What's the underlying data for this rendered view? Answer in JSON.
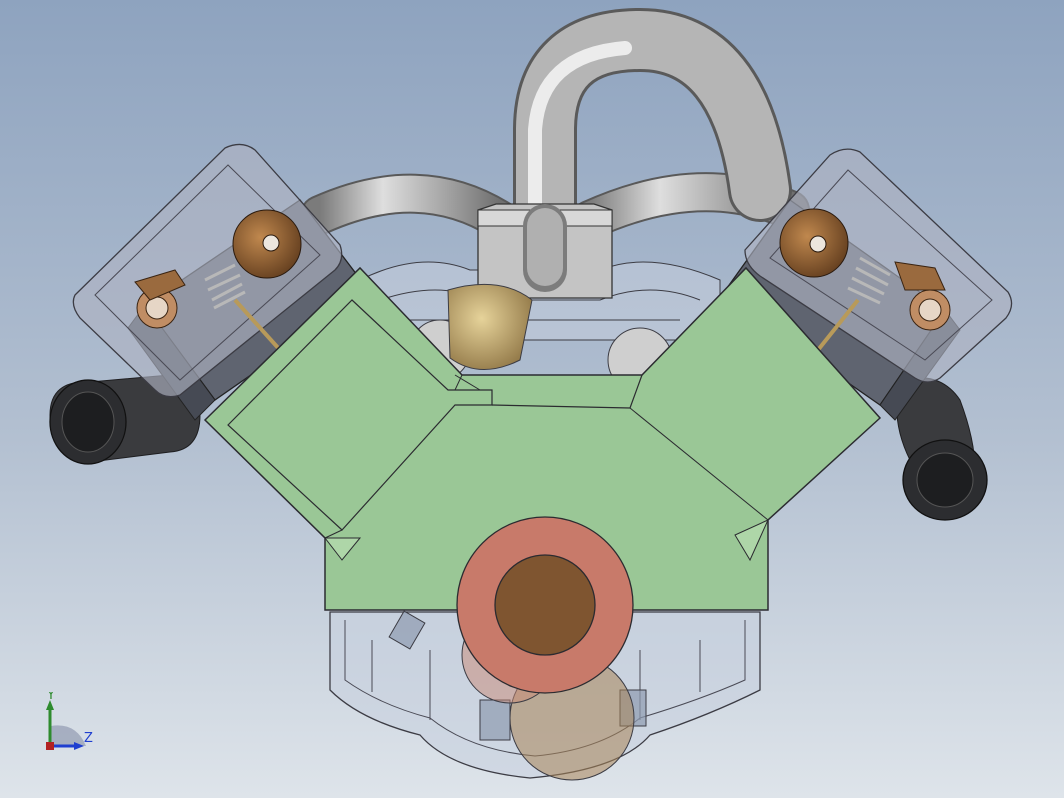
{
  "view": {
    "background_top": "#8ea3bf",
    "background_bottom": "#dee4ea"
  },
  "triad": {
    "y_label": "Y",
    "z_label": "Z",
    "y_color": "#2e8b2e",
    "z_color": "#1f3fd0"
  },
  "model": {
    "colors": {
      "block": "#9ac796",
      "pipe": "#9e9e9e",
      "exhaust": "#3a3b3e",
      "cylinder": "#5f6470",
      "bearing_ring": "#c87a6a",
      "bearing_core": "#7f5530",
      "brass": "#b89a5a",
      "head_cover": "#aeb2c2"
    }
  }
}
